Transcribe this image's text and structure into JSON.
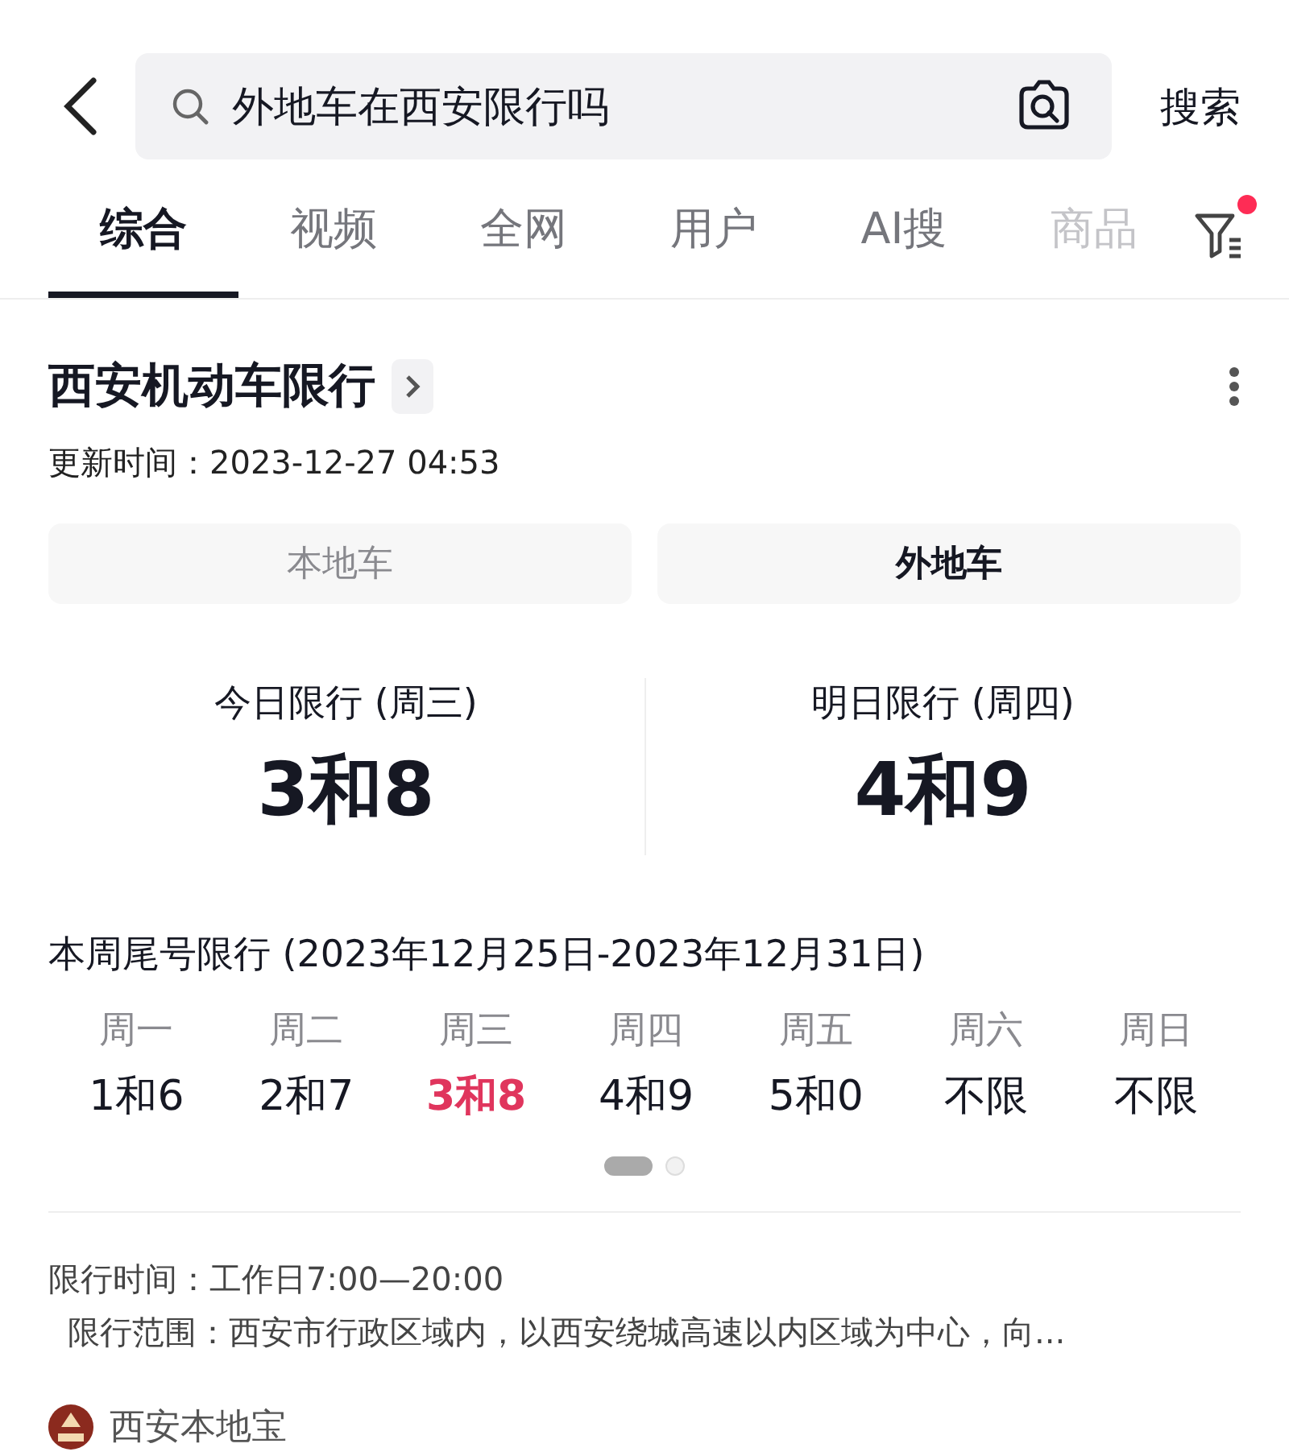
{
  "search": {
    "value": "外地车在西安限行吗",
    "button": "搜索"
  },
  "tabs": [
    {
      "label": "综合",
      "selected": true
    },
    {
      "label": "视频",
      "selected": false
    },
    {
      "label": "全网",
      "selected": false
    },
    {
      "label": "用户",
      "selected": false
    },
    {
      "label": "AI搜",
      "selected": false
    },
    {
      "label": "商品",
      "selected": false
    }
  ],
  "filter": {
    "has_notification": true
  },
  "card": {
    "title": "西安机动车限行",
    "updated": "更新时间：2023-12-27 04:53",
    "segments": [
      {
        "label": "本地车",
        "selected": false
      },
      {
        "label": "外地车",
        "selected": true
      }
    ],
    "summary": [
      {
        "label": "今日限行 (周三)",
        "value": "3和8"
      },
      {
        "label": "明日限行 (周四)",
        "value": "4和9"
      }
    ],
    "week_title": "本周尾号限行 (2023年12月25日-2023年12月31日)",
    "days": [
      {
        "day": "周一",
        "numbers": "1和6",
        "selected": false
      },
      {
        "day": "周二",
        "numbers": "2和7",
        "selected": false
      },
      {
        "day": "周三",
        "numbers": "3和8",
        "selected": true
      },
      {
        "day": "周四",
        "numbers": "4和9",
        "selected": false
      },
      {
        "day": "周五",
        "numbers": "5和0",
        "selected": false
      },
      {
        "day": "周六",
        "numbers": "不限",
        "selected": false
      },
      {
        "day": "周日",
        "numbers": "不限",
        "selected": false
      }
    ],
    "pages": [
      {
        "selected": true
      },
      {
        "selected": false
      }
    ],
    "info": [
      "限行时间：工作日7:00—20:00",
      "限行范围：西安市行政区域内，以西安绕城高速以内区域为中心，向..."
    ],
    "source": "西安本地宝"
  }
}
